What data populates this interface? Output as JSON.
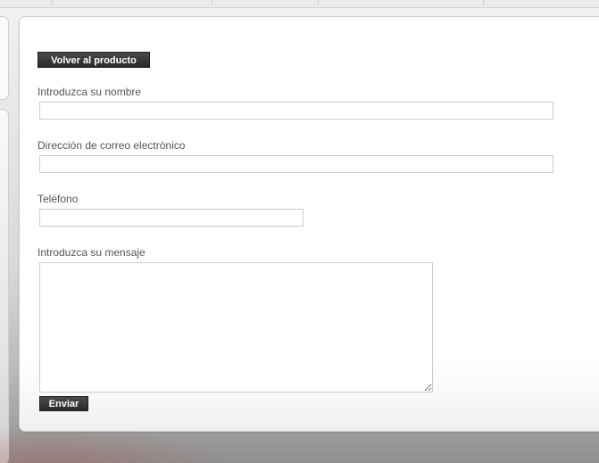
{
  "form": {
    "back_label": "Volver al producto",
    "name_label": "Introduzca su nombre",
    "name_value": "",
    "email_label": "Dirección de correo electrónico",
    "email_value": "",
    "phone_label": "Teléfono",
    "phone_value": "",
    "message_label": "Introduzca su mensaje",
    "message_value": "",
    "submit_label": "Enviar"
  },
  "colors": {
    "button_bg": "#2f2f2f",
    "button_text": "#ffffff",
    "label_text": "#555555",
    "input_border": "#cccccc"
  }
}
